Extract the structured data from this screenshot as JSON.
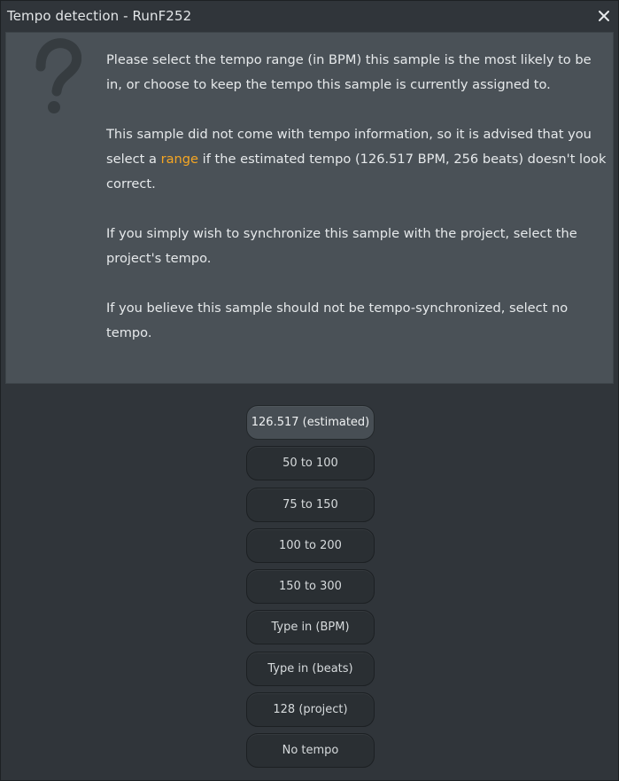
{
  "window": {
    "title": "Tempo detection - RunF252"
  },
  "icons": {
    "close": "close-icon",
    "question": "question-mark-icon"
  },
  "message": {
    "p1": "Please select the tempo range (in BPM) this sample is the most likely to be in, or choose to keep the tempo this sample is currently assigned to.",
    "p2_before": "This sample did not come with tempo information, so it is advised that you select a ",
    "p2_link": "range",
    "p2_after": " if the estimated tempo (126.517 BPM, 256 beats) doesn't look correct.",
    "p3": "If you simply wish to synchronize this sample with the project, select the project's tempo.",
    "p4": "If you believe this sample should not be tempo-synchronized, select no tempo."
  },
  "buttons": [
    {
      "label": "126.517 (estimated)",
      "selected": true
    },
    {
      "label": "50 to 100",
      "selected": false
    },
    {
      "label": "75 to 150",
      "selected": false
    },
    {
      "label": "100 to 200",
      "selected": false
    },
    {
      "label": "150 to 300",
      "selected": false
    },
    {
      "label": "Type in (BPM)",
      "selected": false
    },
    {
      "label": "Type in (beats)",
      "selected": false
    },
    {
      "label": "128 (project)",
      "selected": false
    },
    {
      "label": "No tempo",
      "selected": false
    }
  ],
  "colors": {
    "link": "#f5a623",
    "panel": "#4a5157",
    "background": "#30353a"
  }
}
